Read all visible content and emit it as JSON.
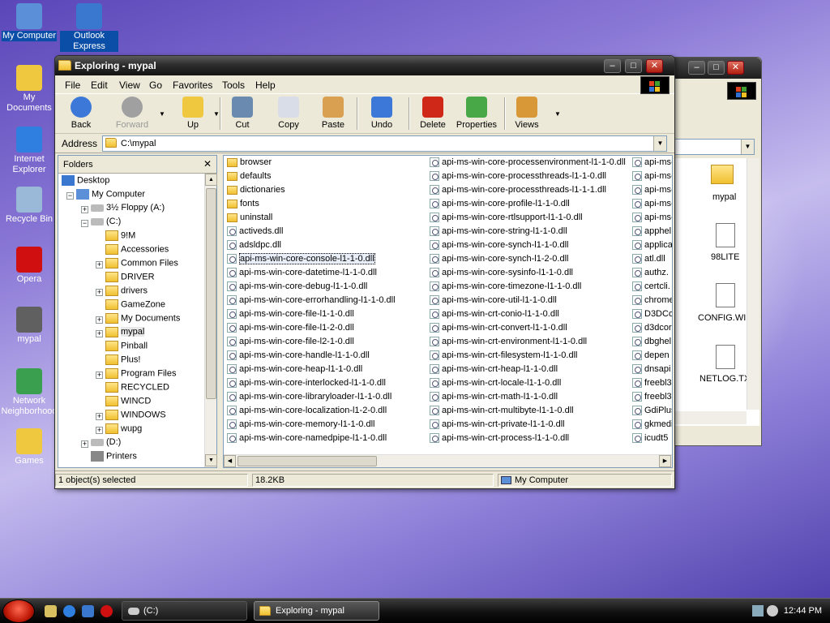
{
  "desktop": {
    "icons": [
      {
        "label": "My Computer",
        "color": "#5b8fd8"
      },
      {
        "label": "Outlook Express",
        "color": "#3a78d0"
      },
      {
        "label": "My Documents",
        "color": "#f0c840"
      },
      {
        "label": "Internet Explorer",
        "color": "#2f7fe0"
      },
      {
        "label": "Recycle Bin",
        "color": "#9ab8d8"
      },
      {
        "label": "Opera",
        "color": "#d01010"
      },
      {
        "label": "mypal",
        "color": "#606060"
      },
      {
        "label": "Network Neighborhood",
        "color": "#3aa050"
      },
      {
        "label": "Games",
        "color": "#f0c840"
      }
    ]
  },
  "back_window": {
    "visible_items": [
      "ents",
      "mypal",
      "98LITE",
      "CONFIG.WI",
      "NETLOG.TX"
    ]
  },
  "window": {
    "title": "Exploring - mypal",
    "min": "–",
    "max": "□",
    "close": "✕"
  },
  "menu": [
    "File",
    "Edit",
    "View",
    "Go",
    "Favorites",
    "Tools",
    "Help"
  ],
  "toolbar": [
    {
      "label": "Back",
      "icon": "back-arrow",
      "enabled": true,
      "color": "#3b78d8"
    },
    {
      "label": "Forward",
      "icon": "forward-arrow",
      "enabled": false,
      "color": "#a0a0a0"
    },
    {
      "label": "Up",
      "icon": "up-folder",
      "enabled": true,
      "color": "#f0c840"
    },
    {
      "label": "Cut",
      "icon": "scissors",
      "enabled": true,
      "color": "#6a8ab0"
    },
    {
      "label": "Copy",
      "icon": "copy-pages",
      "enabled": true,
      "color": "#d8dde8"
    },
    {
      "label": "Paste",
      "icon": "clipboard",
      "enabled": true,
      "color": "#d8a050"
    },
    {
      "label": "Undo",
      "icon": "undo-arrow",
      "enabled": true,
      "color": "#3b78d8"
    },
    {
      "label": "Delete",
      "icon": "red-x",
      "enabled": true,
      "color": "#d02818"
    },
    {
      "label": "Properties",
      "icon": "properties-check",
      "enabled": true,
      "color": "#48a848"
    },
    {
      "label": "Views",
      "icon": "views-grid",
      "enabled": true,
      "color": "#d89838"
    }
  ],
  "address": {
    "label": "Address",
    "value": "C:\\mypal"
  },
  "folders": {
    "header": "Folders",
    "close": "✕",
    "items": [
      {
        "label": "Desktop",
        "x": 0,
        "pm": ""
      },
      {
        "label": "My Computer",
        "x": 1,
        "pm": "-"
      },
      {
        "label": "3½ Floppy (A:)",
        "x": 2,
        "pm": "+"
      },
      {
        "label": "(C:)",
        "x": 2,
        "pm": "-"
      },
      {
        "label": "9!M",
        "x": 3,
        "pm": ""
      },
      {
        "label": "Accessories",
        "x": 3,
        "pm": ""
      },
      {
        "label": "Common Files",
        "x": 3,
        "pm": "+"
      },
      {
        "label": "DRIVER",
        "x": 3,
        "pm": ""
      },
      {
        "label": "drivers",
        "x": 3,
        "pm": "+"
      },
      {
        "label": "GameZone",
        "x": 3,
        "pm": ""
      },
      {
        "label": "My Documents",
        "x": 3,
        "pm": "+"
      },
      {
        "label": "mypal",
        "x": 3,
        "pm": "+",
        "selected": true
      },
      {
        "label": "Pinball",
        "x": 3,
        "pm": ""
      },
      {
        "label": "Plus!",
        "x": 3,
        "pm": ""
      },
      {
        "label": "Program Files",
        "x": 3,
        "pm": "+"
      },
      {
        "label": "RECYCLED",
        "x": 3,
        "pm": ""
      },
      {
        "label": "WINCD",
        "x": 3,
        "pm": ""
      },
      {
        "label": "WINDOWS",
        "x": 3,
        "pm": "+"
      },
      {
        "label": "wupg",
        "x": 3,
        "pm": "+"
      },
      {
        "label": "(D:)",
        "x": 2,
        "pm": "+"
      },
      {
        "label": "Printers",
        "x": 2,
        "pm": ""
      }
    ]
  },
  "files": {
    "columns": [
      [
        {
          "n": "browser",
          "t": "folder"
        },
        {
          "n": "defaults",
          "t": "folder"
        },
        {
          "n": "dictionaries",
          "t": "folder"
        },
        {
          "n": "fonts",
          "t": "folder"
        },
        {
          "n": "uninstall",
          "t": "folder"
        },
        {
          "n": "activeds.dll",
          "t": "dll"
        },
        {
          "n": "adsldpc.dll",
          "t": "dll"
        },
        {
          "n": "api-ms-win-core-console-l1-1-0.dll",
          "t": "dll",
          "sel": true
        },
        {
          "n": "api-ms-win-core-datetime-l1-1-0.dll",
          "t": "dll"
        },
        {
          "n": "api-ms-win-core-debug-l1-1-0.dll",
          "t": "dll"
        },
        {
          "n": "api-ms-win-core-errorhandling-l1-1-0.dll",
          "t": "dll"
        },
        {
          "n": "api-ms-win-core-file-l1-1-0.dll",
          "t": "dll"
        },
        {
          "n": "api-ms-win-core-file-l1-2-0.dll",
          "t": "dll"
        },
        {
          "n": "api-ms-win-core-file-l2-1-0.dll",
          "t": "dll"
        },
        {
          "n": "api-ms-win-core-handle-l1-1-0.dll",
          "t": "dll"
        },
        {
          "n": "api-ms-win-core-heap-l1-1-0.dll",
          "t": "dll"
        },
        {
          "n": "api-ms-win-core-interlocked-l1-1-0.dll",
          "t": "dll"
        },
        {
          "n": "api-ms-win-core-libraryloader-l1-1-0.dll",
          "t": "dll"
        },
        {
          "n": "api-ms-win-core-localization-l1-2-0.dll",
          "t": "dll"
        },
        {
          "n": "api-ms-win-core-memory-l1-1-0.dll",
          "t": "dll"
        },
        {
          "n": "api-ms-win-core-namedpipe-l1-1-0.dll",
          "t": "dll"
        }
      ],
      [
        {
          "n": "api-ms-win-core-processenvironment-l1-1-0.dll",
          "t": "dll"
        },
        {
          "n": "api-ms-win-core-processthreads-l1-1-0.dll",
          "t": "dll"
        },
        {
          "n": "api-ms-win-core-processthreads-l1-1-1.dll",
          "t": "dll"
        },
        {
          "n": "api-ms-win-core-profile-l1-1-0.dll",
          "t": "dll"
        },
        {
          "n": "api-ms-win-core-rtlsupport-l1-1-0.dll",
          "t": "dll"
        },
        {
          "n": "api-ms-win-core-string-l1-1-0.dll",
          "t": "dll"
        },
        {
          "n": "api-ms-win-core-synch-l1-1-0.dll",
          "t": "dll"
        },
        {
          "n": "api-ms-win-core-synch-l1-2-0.dll",
          "t": "dll"
        },
        {
          "n": "api-ms-win-core-sysinfo-l1-1-0.dll",
          "t": "dll"
        },
        {
          "n": "api-ms-win-core-timezone-l1-1-0.dll",
          "t": "dll"
        },
        {
          "n": "api-ms-win-core-util-l1-1-0.dll",
          "t": "dll"
        },
        {
          "n": "api-ms-win-crt-conio-l1-1-0.dll",
          "t": "dll"
        },
        {
          "n": "api-ms-win-crt-convert-l1-1-0.dll",
          "t": "dll"
        },
        {
          "n": "api-ms-win-crt-environment-l1-1-0.dll",
          "t": "dll"
        },
        {
          "n": "api-ms-win-crt-filesystem-l1-1-0.dll",
          "t": "dll"
        },
        {
          "n": "api-ms-win-crt-heap-l1-1-0.dll",
          "t": "dll"
        },
        {
          "n": "api-ms-win-crt-locale-l1-1-0.dll",
          "t": "dll"
        },
        {
          "n": "api-ms-win-crt-math-l1-1-0.dll",
          "t": "dll"
        },
        {
          "n": "api-ms-win-crt-multibyte-l1-1-0.dll",
          "t": "dll"
        },
        {
          "n": "api-ms-win-crt-private-l1-1-0.dll",
          "t": "dll"
        },
        {
          "n": "api-ms-win-crt-process-l1-1-0.dll",
          "t": "dll"
        }
      ],
      [
        {
          "n": "api-ms-",
          "t": "dll"
        },
        {
          "n": "api-ms-",
          "t": "dll"
        },
        {
          "n": "api-ms-",
          "t": "dll"
        },
        {
          "n": "api-ms-",
          "t": "dll"
        },
        {
          "n": "api-ms-",
          "t": "dll"
        },
        {
          "n": "apphel",
          "t": "dll"
        },
        {
          "n": "applica",
          "t": "dll"
        },
        {
          "n": "atl.dll",
          "t": "dll"
        },
        {
          "n": "authz.",
          "t": "dll"
        },
        {
          "n": "certcli.",
          "t": "dll"
        },
        {
          "n": "chrome",
          "t": "dll"
        },
        {
          "n": "D3DCo",
          "t": "dll"
        },
        {
          "n": "d3dcor",
          "t": "dll"
        },
        {
          "n": "dbghel",
          "t": "dll"
        },
        {
          "n": "depen",
          "t": "dll"
        },
        {
          "n": "dnsapi",
          "t": "dll"
        },
        {
          "n": "freebl3",
          "t": "dll"
        },
        {
          "n": "freebl3",
          "t": "dll"
        },
        {
          "n": "GdiPlus",
          "t": "dll"
        },
        {
          "n": "gkmedi",
          "t": "dll"
        },
        {
          "n": "icudt5",
          "t": "dll"
        }
      ]
    ]
  },
  "status": {
    "selected": "1 object(s) selected",
    "size": "18.2KB",
    "location": "My Computer"
  },
  "taskbar": {
    "tasks": [
      "(C:)",
      "Exploring - mypal"
    ],
    "clock": "12:44 PM"
  }
}
